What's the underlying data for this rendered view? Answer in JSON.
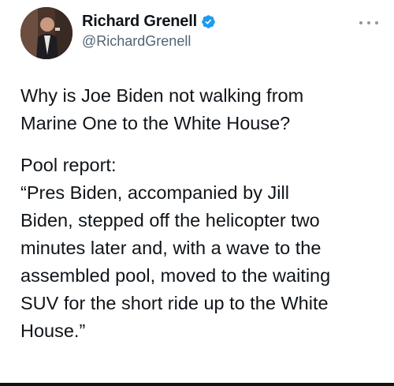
{
  "author": {
    "display_name": "Richard Grenell",
    "handle": "@RichardGrenell",
    "verified_icon": "verified-badge-icon",
    "verified_color": "#1d9bf0"
  },
  "menu": {
    "more_icon": "more-options-icon"
  },
  "tweet": {
    "paragraph1_lines": [
      "Why is Joe Biden not walking from",
      "Marine One to the White House?"
    ],
    "paragraph2_lines": [
      "Pool report:",
      "“Pres Biden, accompanied by Jill",
      "Biden, stepped off the helicopter two",
      "minutes later and, with a wave to the",
      "assembled pool, moved to the waiting",
      "SUV for the short ride up to the White",
      "House.”"
    ]
  }
}
